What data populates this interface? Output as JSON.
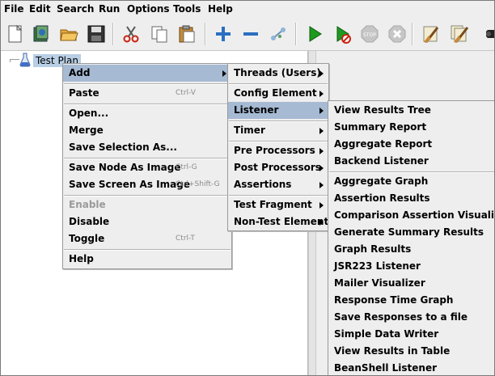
{
  "menubar": [
    {
      "label": "File"
    },
    {
      "label": "Edit"
    },
    {
      "label": "Search"
    },
    {
      "label": "Run"
    },
    {
      "label": "Options"
    },
    {
      "label": "Tools"
    },
    {
      "label": "Help"
    }
  ],
  "toolbar_icons": [
    "new-icon",
    "templates-icon",
    "open-icon",
    "save-icon",
    "cut-icon",
    "copy-icon",
    "paste-icon",
    "expand-icon",
    "collapse-icon",
    "toggle-icon",
    "start-icon",
    "start-no-pause-icon",
    "stop-icon",
    "shutdown-icon",
    "clear-icon",
    "clear-all-icon",
    "search-icon"
  ],
  "tree": {
    "root_label": "Test Plan"
  },
  "context_menu": {
    "items": [
      {
        "label": "Add",
        "shortcut": "",
        "submenu": true,
        "selected": true,
        "enabled": true
      },
      {
        "label": "Paste",
        "shortcut": "Ctrl-V",
        "enabled": true
      },
      {
        "label": "Open...",
        "shortcut": "",
        "enabled": true
      },
      {
        "label": "Merge",
        "shortcut": "",
        "enabled": true
      },
      {
        "label": "Save Selection As...",
        "shortcut": "",
        "enabled": true
      },
      {
        "label": "Save Node As Image",
        "shortcut": "Ctrl-G",
        "enabled": true
      },
      {
        "label": "Save Screen As Image",
        "shortcut": "Ctrl+Shift-G",
        "enabled": true
      },
      {
        "label": "Enable",
        "shortcut": "",
        "enabled": false
      },
      {
        "label": "Disable",
        "shortcut": "",
        "enabled": true
      },
      {
        "label": "Toggle",
        "shortcut": "Ctrl-T",
        "enabled": true
      },
      {
        "label": "Help",
        "shortcut": "",
        "enabled": true
      }
    ]
  },
  "add_submenu": {
    "items": [
      {
        "label": "Threads (Users)",
        "submenu": true
      },
      {
        "label": "Config Element",
        "submenu": true
      },
      {
        "label": "Listener",
        "submenu": true,
        "selected": true
      },
      {
        "label": "Timer",
        "submenu": true
      },
      {
        "label": "Pre Processors",
        "submenu": true
      },
      {
        "label": "Post Processors",
        "submenu": true
      },
      {
        "label": "Assertions",
        "submenu": true
      },
      {
        "label": "Test Fragment",
        "submenu": true
      },
      {
        "label": "Non-Test Elements",
        "submenu": true
      }
    ]
  },
  "listener_submenu": {
    "items": [
      {
        "label": "View Results Tree"
      },
      {
        "label": "Summary Report"
      },
      {
        "label": "Aggregate Report"
      },
      {
        "label": "Backend Listener"
      },
      {
        "label": "Aggregate Graph"
      },
      {
        "label": "Assertion Results"
      },
      {
        "label": "Comparison Assertion Visualizer"
      },
      {
        "label": "Generate Summary Results"
      },
      {
        "label": "Graph Results"
      },
      {
        "label": "JSR223 Listener"
      },
      {
        "label": "Mailer Visualizer"
      },
      {
        "label": "Response Time Graph"
      },
      {
        "label": "Save Responses to a file"
      },
      {
        "label": "Simple Data Writer"
      },
      {
        "label": "View Results in Table"
      },
      {
        "label": "BeanShell Listener"
      }
    ]
  },
  "colors": {
    "selection": "#a6bad3",
    "tree_selection": "#b8cfe5",
    "background": "#eeeeee"
  }
}
